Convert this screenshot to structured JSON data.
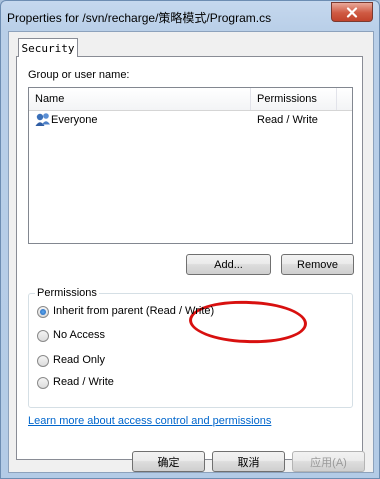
{
  "window": {
    "title": "Properties for /svn/recharge/策略模式/Program.cs",
    "close_glyph": "X"
  },
  "tabs": [
    {
      "label": "Security"
    }
  ],
  "security": {
    "group_label": "Group or user name:",
    "columns": [
      "Name",
      "Permissions"
    ],
    "rows": [
      {
        "name": "Everyone",
        "permissions": "Read / Write",
        "icon": "group-users-icon"
      }
    ],
    "add_label": "Add...",
    "remove_label": "Remove",
    "permissions_group": {
      "title": "Permissions",
      "options": [
        {
          "label": "Inherit from parent (Read / Write)",
          "selected": true
        },
        {
          "label": "No Access",
          "selected": false
        },
        {
          "label": "Read Only",
          "selected": false
        },
        {
          "label": "Read / Write",
          "selected": false
        }
      ]
    },
    "learn_more_link": "Learn more about access control and permissions"
  },
  "buttons": {
    "ok": "确定",
    "cancel": "取消",
    "apply": "应用(A)"
  },
  "colors": {
    "frame": "#b9cfe8",
    "link": "#0066cc",
    "annotation": "#d8100f"
  }
}
